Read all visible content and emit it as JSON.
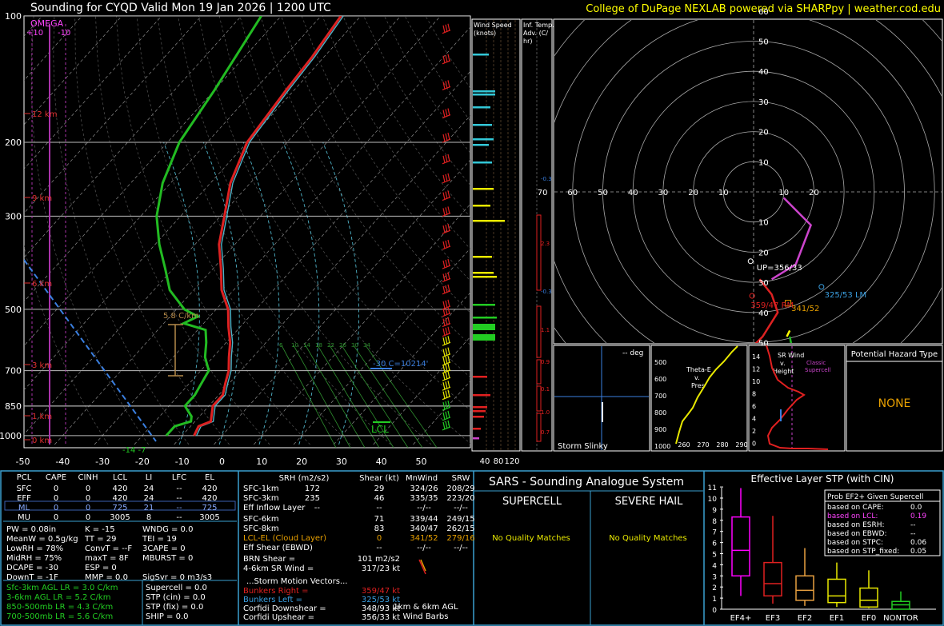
{
  "header": {
    "title": "Sounding for CYQD Valid  Mon 19 Jan 2026 | 1200 UTC",
    "credit": "College of DuPage NEXLAB powered via SHARPpy | weather.cod.edu"
  },
  "skewt": {
    "omega_label": "OMEGA",
    "omega_ticks": [
      "+10",
      "-10"
    ],
    "pressure_levels": [
      100,
      200,
      300,
      500,
      700,
      850,
      1000
    ],
    "temperature_ticks": [
      -50,
      -40,
      -30,
      -20,
      -10,
      0,
      10,
      20,
      30,
      40,
      50
    ],
    "height_labels": [
      "12 km",
      "9 km",
      "6 km",
      "3 km",
      "1 km",
      "0 km"
    ],
    "lapse_label": "5.8 C/km",
    "dgz_label": "-30 C=10214'",
    "lcl_label": "LCL",
    "sfc_values": "-14 -7",
    "mixing_ratios": [
      "6",
      "10",
      "14",
      "18",
      "22",
      "26",
      "30",
      "34"
    ]
  },
  "chart_data": [
    {
      "type": "line",
      "title": "Sounding for CYQD Valid  Mon 19 Jan 2026 | 1200 UTC",
      "xlabel": "",
      "ylabel": "",
      "y_scale": "log-pressure",
      "ylim": [
        1050,
        100
      ],
      "xlim": [
        -50,
        50
      ],
      "series": [
        {
          "name": "temperature",
          "color": "#dd2222",
          "pressure": [
            1000,
            950,
            925,
            900,
            850,
            800,
            750,
            700,
            650,
            600,
            550,
            500,
            450,
            400,
            350,
            300,
            250,
            200,
            150,
            125,
            100
          ],
          "values": [
            -7,
            -8,
            -6,
            -7,
            -9,
            -9,
            -11,
            -13,
            -16,
            -19,
            -23,
            -27,
            -33,
            -38,
            -44,
            -49,
            -55,
            -60,
            -62,
            -63,
            -65
          ]
        },
        {
          "name": "dewpoint",
          "color": "#22bb22",
          "pressure": [
            1000,
            950,
            925,
            900,
            850,
            800,
            750,
            700,
            650,
            600,
            560,
            540,
            520,
            500,
            450,
            400,
            350,
            300,
            250,
            200,
            150,
            100
          ],
          "values": [
            -14,
            -14,
            -11,
            -12,
            -16,
            -16,
            -17,
            -18,
            -22,
            -25,
            -28,
            -35,
            -33,
            -38,
            -46,
            -52,
            -59,
            -66,
            -72,
            -77,
            -80,
            -85
          ]
        }
      ]
    },
    {
      "type": "line",
      "title": "Hodograph",
      "xlim": [
        -70,
        70
      ],
      "ylim": [
        -70,
        70
      ],
      "rings": [
        10,
        20,
        30,
        40,
        50,
        60
      ],
      "series": [
        {
          "name": "0-1km",
          "color": "#dd2222",
          "u": [
            -5,
            -6,
            -2,
            3,
            8,
            6,
            2
          ],
          "v": [
            -62,
            -58,
            -53,
            -48,
            -40,
            -34,
            -29
          ]
        },
        {
          "name": "3-6km",
          "color": "#22bb22",
          "u": [
            11,
            12,
            13,
            12
          ],
          "v": [
            -62,
            -58,
            -53,
            -48
          ]
        },
        {
          "name": "6-9km",
          "color": "#ffff00",
          "u": [
            11,
            12
          ],
          "v": [
            -48,
            -46
          ]
        },
        {
          "name": "9-12km",
          "color": "#cc44cc",
          "u": [
            6,
            14,
            19,
            16,
            10
          ],
          "v": [
            -29,
            -24,
            -11,
            -8,
            -2
          ]
        }
      ]
    },
    {
      "type": "bar",
      "title": "Effective Layer STP (with CIN)",
      "categories": [
        "EF4+",
        "EF3",
        "EF2",
        "EF1",
        "EF0",
        "NONTOR"
      ],
      "ylim": [
        0,
        11
      ],
      "series": [
        {
          "name": "q10",
          "values": [
            1.2,
            0.5,
            0.3,
            0.2,
            0.1,
            0.0
          ]
        },
        {
          "name": "q25",
          "values": [
            3.0,
            1.2,
            0.8,
            0.6,
            0.2,
            0.0
          ]
        },
        {
          "name": "median",
          "values": [
            5.3,
            2.3,
            1.7,
            1.2,
            0.8,
            0.4
          ]
        },
        {
          "name": "q75",
          "values": [
            8.3,
            4.2,
            3.0,
            2.7,
            1.9,
            0.7
          ]
        },
        {
          "name": "q90",
          "values": [
            10.9,
            8.4,
            5.5,
            4.2,
            3.5,
            1.6
          ]
        }
      ]
    }
  ],
  "panels": {
    "wind_speed": {
      "label": "Wind Speed (knots)",
      "ticks": [
        "40",
        "80",
        "120"
      ]
    },
    "temp_adv": {
      "label": "Inf. Temp. Adv. (C/hr)",
      "values": [
        "-0.3",
        "2.3",
        "-0.3",
        "1.1",
        "0.9",
        "0.1",
        "1.0",
        "0.7"
      ]
    },
    "hodograph": {
      "ring_labels": [
        "60",
        "50",
        "40",
        "30",
        "20",
        "10"
      ],
      "x_labels": [
        "70",
        "60",
        "50",
        "40",
        "30",
        "20",
        "10"
      ],
      "x_labels_right": [
        "10",
        "20"
      ],
      "lower_labels": [
        "10",
        "20",
        "30",
        "40",
        "50",
        "60"
      ],
      "up": "UP=356/33",
      "lm": "325/53 LM",
      "rm": "359/47 RM",
      "mean": "341/52"
    },
    "slinky": {
      "title": "Storm Slinky",
      "deg": "-- deg"
    },
    "theta": {
      "title": "Theta-E v. Pres",
      "pres": [
        "500",
        "600",
        "700",
        "800",
        "900",
        "1000"
      ],
      "x": [
        "260",
        "270",
        "280",
        "290"
      ]
    },
    "srwind": {
      "title": "SR Wind v. Height",
      "classic": "Classic Supercell",
      "heights": [
        "14",
        "12",
        "10",
        "8",
        "6",
        "4",
        "2",
        "0"
      ],
      "x": [
        "0",
        "20",
        "40",
        "60",
        "80"
      ]
    },
    "hazard": {
      "title": "Potential Hazard Type",
      "value": "NONE"
    }
  },
  "parcels": {
    "headers": [
      "PCL",
      "CAPE",
      "CINH",
      "LCL",
      "LI",
      "LFC",
      "EL"
    ],
    "rows": [
      [
        "SFC",
        "0",
        "0",
        "420",
        "24",
        "--",
        "420"
      ],
      [
        "EFF",
        "0",
        "0",
        "420",
        "24",
        "--",
        "420"
      ],
      [
        "ML",
        "0",
        "0",
        "725",
        "21",
        "--",
        "725"
      ],
      [
        "MU",
        "0",
        "0",
        "3005",
        "8",
        "--",
        "3005"
      ]
    ]
  },
  "indices": [
    [
      "PW = 0.08in",
      "K = -15",
      "WNDG = 0.0"
    ],
    [
      "MeanW = 0.5g/kg",
      "TT = 29",
      "TEI = 19"
    ],
    [
      "LowRH = 78%",
      "ConvT = --F",
      "3CAPE = 0"
    ],
    [
      "MidRH = 75%",
      "maxT = 8F",
      "MBURST = 0"
    ],
    [
      "DCAPE = -30",
      "ESP = 0",
      ""
    ],
    [
      "DownT = -1F",
      "MMP = 0.0",
      "SigSvr = 0 m3/s3"
    ]
  ],
  "lapse_rates": [
    "Sfc-3km AGL LR = 3.0 C/km",
    "3-6km AGL LR = 5.2 C/km",
    "850-500mb LR = 4.3 C/km",
    "700-500mb LR = 5.6 C/km"
  ],
  "composites": [
    "Supercell = 0.0",
    "STP (cin) = 0.0",
    "STP (fix) = 0.0",
    "SHIP = 0.0"
  ],
  "kinematics": {
    "headers": [
      "SRH (m2/s2)",
      "Shear (kt)",
      "MnWind",
      "SRW"
    ],
    "rows": [
      [
        "SFC-1km",
        "172",
        "29",
        "324/26",
        "208/29"
      ],
      [
        "SFC-3km",
        "235",
        "46",
        "335/35",
        "223/20"
      ],
      [
        "Eff Inflow Layer",
        "--",
        "--",
        "--/--",
        "--/--"
      ],
      [
        "SFC-6km",
        "71",
        "339/44",
        "249/15"
      ],
      [
        "SFC-8km",
        "83",
        "340/47",
        "262/15"
      ],
      [
        "LCL-EL (Cloud Layer)",
        "0",
        "341/52",
        "279/16"
      ],
      [
        "Eff Shear (EBWD)",
        "--",
        "--/--",
        "--/--"
      ]
    ],
    "brn": "BRN Shear =",
    "brn_v": "101 m2/s2",
    "sr46": "4-6km SR Wind =",
    "sr46_v": "317/23 kt",
    "sm_title": "...Storm Motion Vectors...",
    "sm": [
      [
        "Bunkers Right =",
        "359/47 kt"
      ],
      [
        "Bunkers Left =",
        "325/53 kt"
      ],
      [
        "Corfidi Downshear =",
        "348/93 kt"
      ],
      [
        "Corfidi Upshear =",
        "356/33 kt"
      ]
    ],
    "barbs_label1": "1km & 6km AGL",
    "barbs_label2": "Wind Barbs"
  },
  "sars": {
    "title": "SARS - Sounding Analogue System",
    "supercell": "SUPERCELL",
    "hail": "SEVERE HAIL",
    "supercell_val": "No Quality Matches",
    "hail_val": "No Quality Matches"
  },
  "stp": {
    "title": "Effective Layer STP (with CIN)",
    "prob_title": "Prob EF2+ Given Supercell",
    "prob": [
      [
        "based on CAPE:",
        "0.0"
      ],
      [
        "based on LCL:",
        "0.19"
      ],
      [
        "based on ESRH:",
        "--"
      ],
      [
        "based on EBWD:",
        "--"
      ],
      [
        "based on STPC:",
        "0.06"
      ],
      [
        "based on STP_fixed:",
        "0.05"
      ]
    ],
    "yticks": [
      "0",
      "1",
      "2",
      "3",
      "4",
      "5",
      "6",
      "7",
      "8",
      "9",
      "10",
      "11"
    ]
  }
}
